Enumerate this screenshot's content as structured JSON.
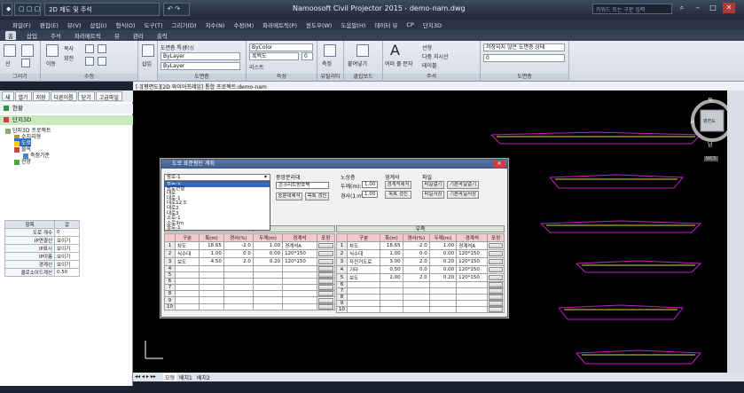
{
  "titlebar": {
    "app_title": "Namoosoft Civil Projector 2015 - demo-nam.dwg",
    "workspace": "2D 제도 및 주석",
    "search_placeholder": "키워드 또는 구문 입력"
  },
  "menubar": [
    "파일(F)",
    "편집(E)",
    "뷰(V)",
    "삽입(I)",
    "형식(O)",
    "도구(T)",
    "그리기(D)",
    "치수(N)",
    "수정(M)",
    "파라메트릭(P)",
    "윈도우(W)",
    "도움말(H)",
    "데이터 뷰",
    "CP",
    "단지3D"
  ],
  "ribbon_tabs": [
    "홈",
    "삽입",
    "주석",
    "파라메트릭",
    "뷰",
    "관리",
    "출력"
  ],
  "ribbon": {
    "groups": [
      "그리기",
      "수정",
      "도면층",
      "특성",
      "유틸리티",
      "클립보드",
      "주석",
      "도면층"
    ],
    "items": {
      "line": "선",
      "move": "이동",
      "copy": "복사",
      "rotate": "회전",
      "layer_props": "도면층 특성",
      "bylayer": "ByLayer",
      "bycolor": "ByColor",
      "create": "작성",
      "edit": "편집",
      "block_edit": "속성 편집",
      "measure": "측정",
      "paste": "붙여넣기",
      "multi_text": "여러 줄 문자",
      "linear": "선형",
      "multileader": "다중 지시선",
      "table": "테이블",
      "layer_state": "저장되지 않은 도면층 상태",
      "layer_value": "0",
      "insert": "삽입",
      "list": "리스트",
      "color_value": "흑백도",
      "num": "0"
    }
  },
  "viewport_caption": "[-][평면도][2D 와이어프레임]   통합 프로젝트:demo-nam",
  "left_tabs": [
    "새",
    "열기",
    "저장",
    "다른이름",
    "닫기",
    "고급파일"
  ],
  "left_panel": {
    "status": "현황",
    "project_tree_root": "단지3D",
    "tree": [
      "단지3D 프로젝트",
      "수치지형",
      "도로",
      "블록",
      "측점기준",
      "관망"
    ],
    "prop_headers": [
      "항목",
      "값"
    ],
    "props": [
      {
        "k": "도로 개수",
        "v": "0"
      },
      {
        "k": "IP연결선",
        "v": "보이기"
      },
      {
        "k": "IP표시",
        "v": "보이기"
      },
      {
        "k": "IP이름",
        "v": "보이기"
      },
      {
        "k": "경계선",
        "v": "보이기"
      },
      {
        "k": "클로소이드계산",
        "v": "0.50"
      }
    ]
  },
  "bottom_tabs": [
    "모형",
    "배치1",
    "배치2"
  ],
  "dialog": {
    "title": "도로 표준횡단 계획",
    "selected_type": "왕로-1",
    "type_options": [
      "왕로-1",
      "왕로연결",
      "대로",
      "대로-1",
      "대로12.5",
      "대로2",
      "대로3",
      "소로-1",
      "소로3m",
      "중로-1",
      "중로-2",
      "중로-3"
    ],
    "median_label": "중앙분리대",
    "median_value": "콘크리트방호벽",
    "median_btn": "중분대제작",
    "median_list_btn": "목록 갱신",
    "shoulder_label": "노상층",
    "thickness_label": "두께(m):",
    "thickness_value": "1.00",
    "slope_label": "경사(1:m):",
    "slope_value": "1.00",
    "boundary_label": "경계석",
    "boundary_make_btn": "경계석제작",
    "boundary_list_btn": "목록 갱신",
    "file_label": "파일",
    "file_open_btn": "파일열기",
    "file_save_btn": "파일저장",
    "default_open_btn": "기본파일열기",
    "default_save_btn": "기본파일저장",
    "left_side": "좌측",
    "right_side": "우측",
    "headers": [
      "구분",
      "폭(m)",
      "경사(%)",
      "두께(m)",
      "경계석",
      "포장"
    ],
    "left_rows": [
      {
        "n": "1",
        "kind": "차도",
        "w": "18.65",
        "s": "-2.0",
        "t": "1.00",
        "b": "경계석A"
      },
      {
        "n": "2",
        "kind": "식수대",
        "w": "1.00",
        "s": "0.0",
        "t": "0.00",
        "b": "120*150"
      },
      {
        "n": "3",
        "kind": "보도",
        "w": "4.50",
        "s": "2.0",
        "t": "0.20",
        "b": "120*150"
      },
      {
        "n": "4"
      },
      {
        "n": "5"
      },
      {
        "n": "6"
      },
      {
        "n": "7"
      },
      {
        "n": "8"
      },
      {
        "n": "9"
      },
      {
        "n": "10"
      }
    ],
    "right_rows": [
      {
        "n": "1",
        "kind": "차도",
        "w": "18.65",
        "s": "-2.0",
        "t": "1.00",
        "b": "경계석A"
      },
      {
        "n": "2",
        "kind": "식수대",
        "w": "1.00",
        "s": "0.0",
        "t": "0.00",
        "b": "120*150"
      },
      {
        "n": "3",
        "kind": "자전거도로",
        "w": "3.00",
        "s": "2.0",
        "t": "0.20",
        "b": "120*150"
      },
      {
        "n": "4",
        "kind": "기타",
        "w": "0.50",
        "s": "0.0",
        "t": "0.00",
        "b": "120*150"
      },
      {
        "n": "5",
        "kind": "보도",
        "w": "2.00",
        "s": "2.0",
        "t": "0.20",
        "b": "120*150"
      },
      {
        "n": "6"
      },
      {
        "n": "7"
      },
      {
        "n": "8"
      },
      {
        "n": "9"
      },
      {
        "n": "10"
      }
    ]
  },
  "viewcube": {
    "north": "북",
    "south": "남",
    "east": "동",
    "west": "서",
    "face": "평면도",
    "wcs": "WCS"
  },
  "colors": {
    "drawing": "#c020c0",
    "accent": "#316ac5",
    "header_pink": "#f3c9cc"
  }
}
